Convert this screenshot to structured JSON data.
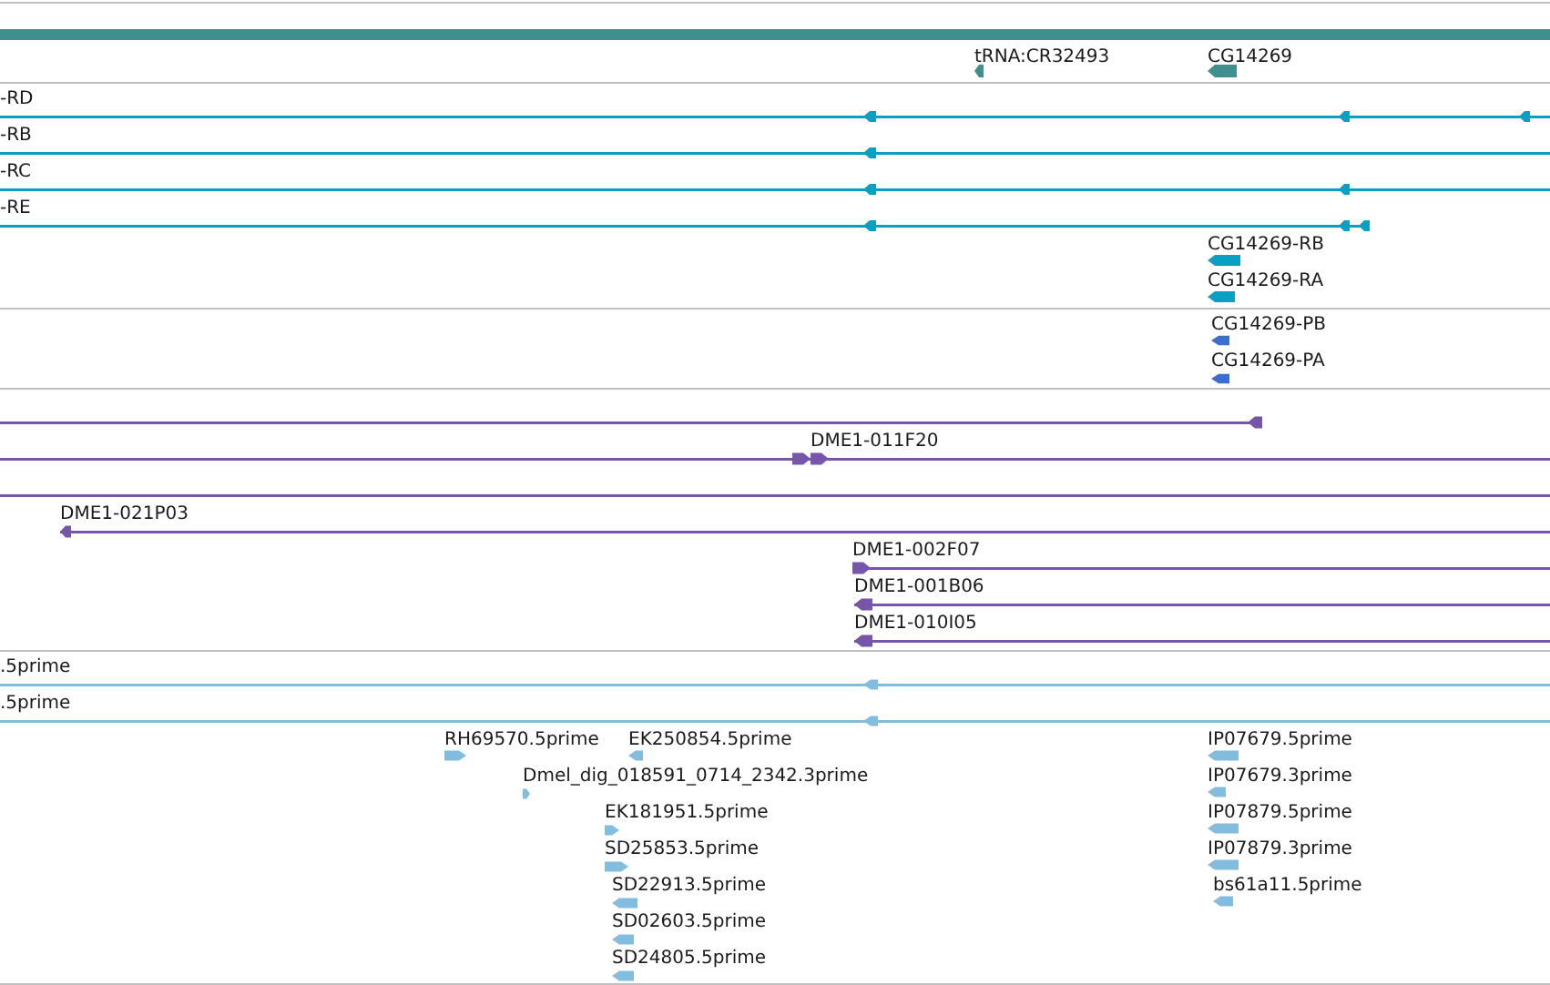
{
  "tracks": [
    {
      "kind": "gene",
      "color": "#3f8f8f",
      "features": [
        {
          "label": "tRNA:CR32493",
          "reverse": true
        },
        {
          "label": "CG14269",
          "reverse": true
        }
      ]
    },
    {
      "kind": "transcript",
      "color": "#0aa0c4",
      "features": [
        {
          "label": "-RD",
          "reverse": true
        },
        {
          "label": "-RB",
          "reverse": true
        },
        {
          "label": "-RC",
          "reverse": true
        },
        {
          "label": "-RE",
          "reverse": true
        },
        {
          "label": "CG14269-RB",
          "reverse": true
        },
        {
          "label": "CG14269-RA",
          "reverse": true
        }
      ]
    },
    {
      "kind": "protein",
      "color": "#3a6fd0",
      "features": [
        {
          "label": "CG14269-PB",
          "reverse": true
        },
        {
          "label": "CG14269-PA",
          "reverse": true
        }
      ]
    },
    {
      "kind": "clone",
      "color": "#7755aa",
      "features": [
        {
          "reverse": true
        },
        {
          "label": "DME1-011F20",
          "reverse": false
        },
        {
          "arrowheads": false
        },
        {
          "label": "DME1-021P03",
          "reverse": true
        },
        {
          "label": "DME1-002F07",
          "reverse": false
        },
        {
          "label": "DME1-001B06",
          "reverse": true
        },
        {
          "label": "DME1-010I05",
          "reverse": true
        }
      ]
    },
    {
      "kind": "est",
      "color": "#82bde0",
      "features": [
        {
          "label": ".5prime",
          "reverse": true
        },
        {
          "label": ".5prime",
          "reverse": true
        },
        {
          "label": "RH69570.5prime",
          "reverse": false
        },
        {
          "label": "EK250854.5prime",
          "reverse": true
        },
        {
          "label": "IP07679.5prime",
          "reverse": true
        },
        {
          "label": "Dmel_dig_018591_0714_2342.3prime",
          "reverse": false
        },
        {
          "label": "IP07679.3prime",
          "reverse": true
        },
        {
          "label": "EK181951.5prime",
          "reverse": false
        },
        {
          "label": "IP07879.5prime",
          "reverse": true
        },
        {
          "label": "SD25853.5prime",
          "reverse": false
        },
        {
          "label": "IP07879.3prime",
          "reverse": true
        },
        {
          "label": "SD22913.5prime",
          "reverse": true
        },
        {
          "label": "bs61a11.5prime",
          "reverse": true
        },
        {
          "label": "SD02603.5prime",
          "reverse": true
        },
        {
          "label": "SD24805.5prime",
          "reverse": true
        }
      ]
    }
  ]
}
